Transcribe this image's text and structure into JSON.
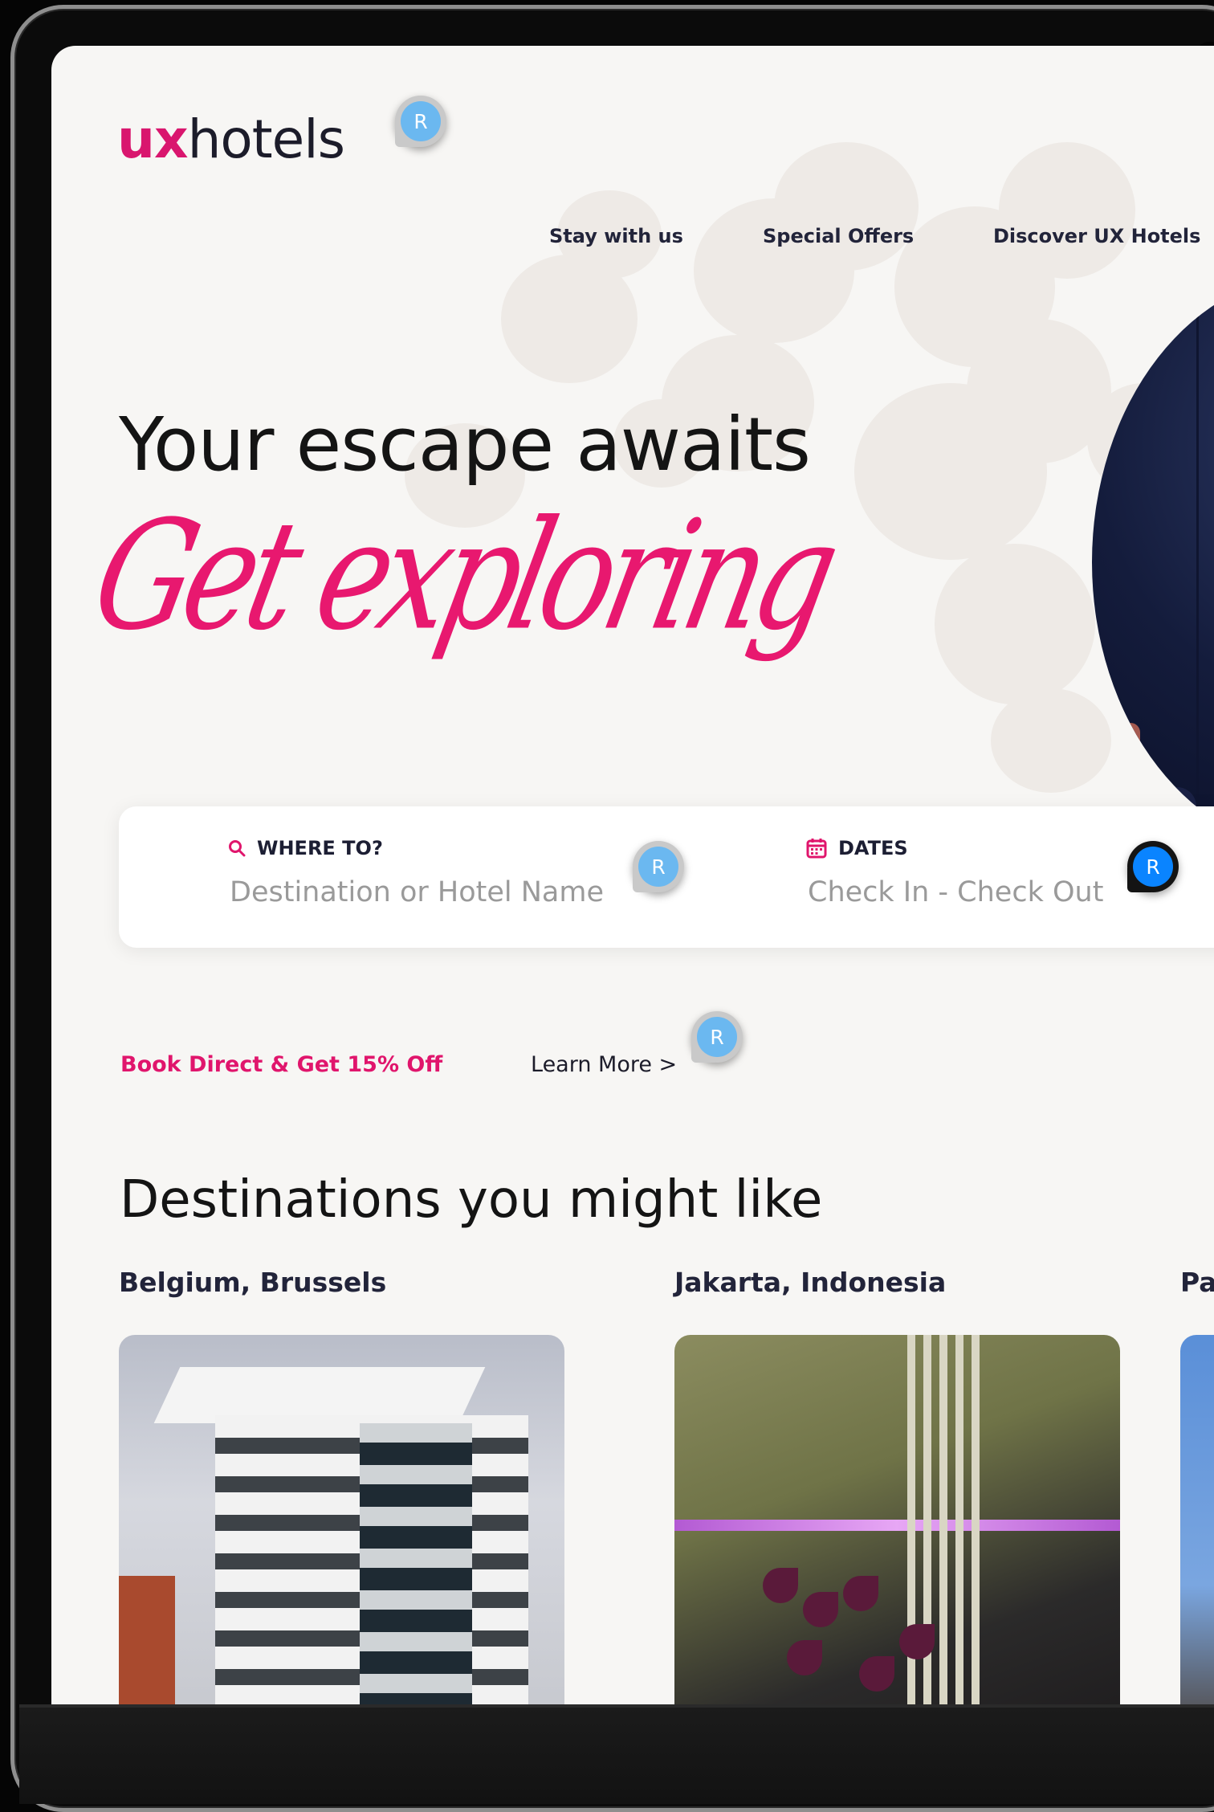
{
  "brand": {
    "logo_ux": "ux",
    "logo_hotels": "hotels",
    "accent": "#e0156c"
  },
  "nav": {
    "items": [
      "Stay with us",
      "Special Offers",
      "Discover UX Hotels"
    ]
  },
  "review_badge": {
    "label": "R"
  },
  "hero": {
    "title": "Your escape awaits",
    "script": "Get exploring"
  },
  "search": {
    "where": {
      "label": "WHERE TO?",
      "placeholder": "Destination or Hotel Name",
      "icon": "search-icon"
    },
    "dates": {
      "label": "DATES",
      "placeholder": "Check In - Check Out",
      "icon": "calendar-icon"
    }
  },
  "promo": {
    "text": "Book Direct & Get 15% Off",
    "link": "Learn More >"
  },
  "destinations": {
    "title": "Destinations you might like",
    "items": [
      {
        "name": "Belgium, Brussels"
      },
      {
        "name": "Jakarta, Indonesia"
      },
      {
        "name": "Pa"
      }
    ]
  }
}
